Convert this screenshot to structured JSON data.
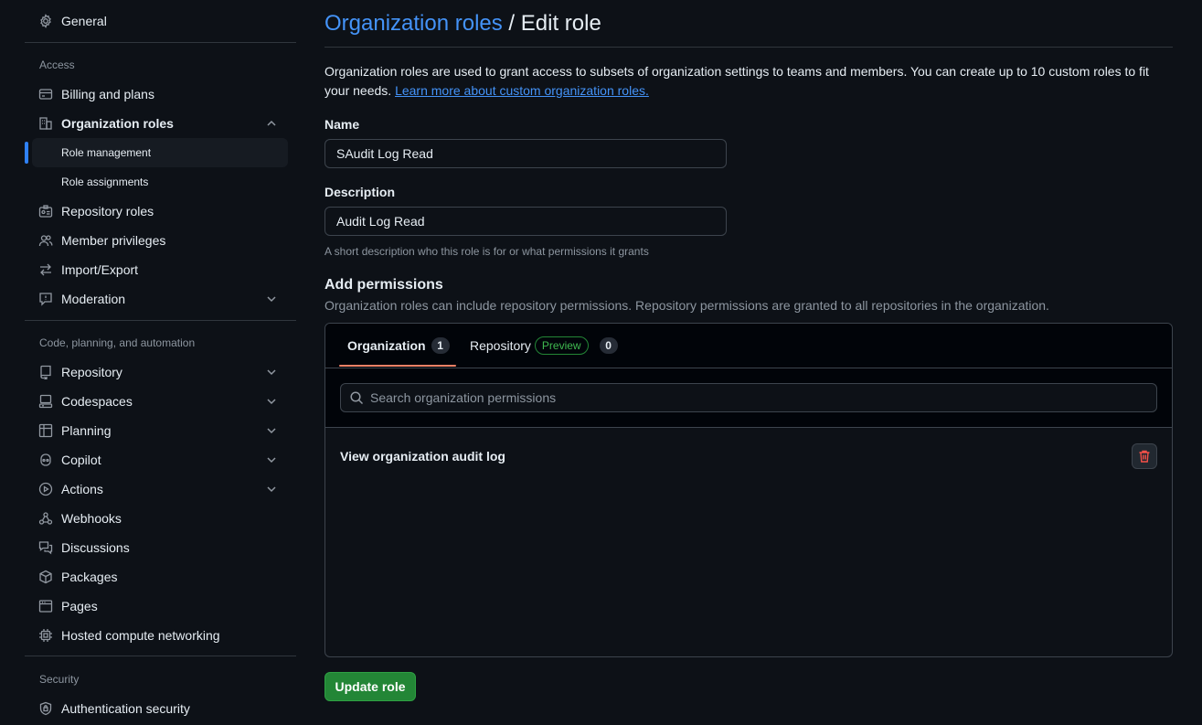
{
  "sidebar": {
    "general": "General",
    "access_heading": "Access",
    "billing": "Billing and plans",
    "org_roles": "Organization roles",
    "role_management": "Role management",
    "role_assignments": "Role assignments",
    "repo_roles": "Repository roles",
    "member_privileges": "Member privileges",
    "import_export": "Import/Export",
    "moderation": "Moderation",
    "code_heading": "Code, planning, and automation",
    "repository": "Repository",
    "codespaces": "Codespaces",
    "planning": "Planning",
    "copilot": "Copilot",
    "actions": "Actions",
    "webhooks": "Webhooks",
    "discussions": "Discussions",
    "packages": "Packages",
    "pages": "Pages",
    "hosted_compute": "Hosted compute networking",
    "security_heading": "Security",
    "auth_security": "Authentication security"
  },
  "main": {
    "breadcrumb_link": "Organization roles",
    "breadcrumb_sep": " / ",
    "breadcrumb_current": "Edit role",
    "intro_text": "Organization roles are used to grant access to subsets of organization settings to teams and members. You can create up to 10 custom roles to fit your needs. ",
    "intro_link": "Learn more about custom organization roles.",
    "name_label": "Name",
    "name_value": "SAudit Log Read",
    "description_label": "Description",
    "description_value": "Audit Log Read",
    "description_hint": "A short description who this role is for or what permissions it grants",
    "permissions_title": "Add permissions",
    "permissions_desc": "Organization roles can include repository permissions. Repository permissions are granted to all repositories in the organization.",
    "tabs": {
      "organization_label": "Organization",
      "organization_count": "1",
      "repository_label": "Repository",
      "repository_badge": "Preview",
      "repository_count": "0"
    },
    "search_placeholder": "Search organization permissions",
    "permission_item": "View organization audit log",
    "update_button": "Update role"
  },
  "colors": {
    "accent_link": "#4493f8",
    "tab_underline": "#f78166",
    "primary_button": "#238636",
    "danger_icon": "#f85149"
  }
}
